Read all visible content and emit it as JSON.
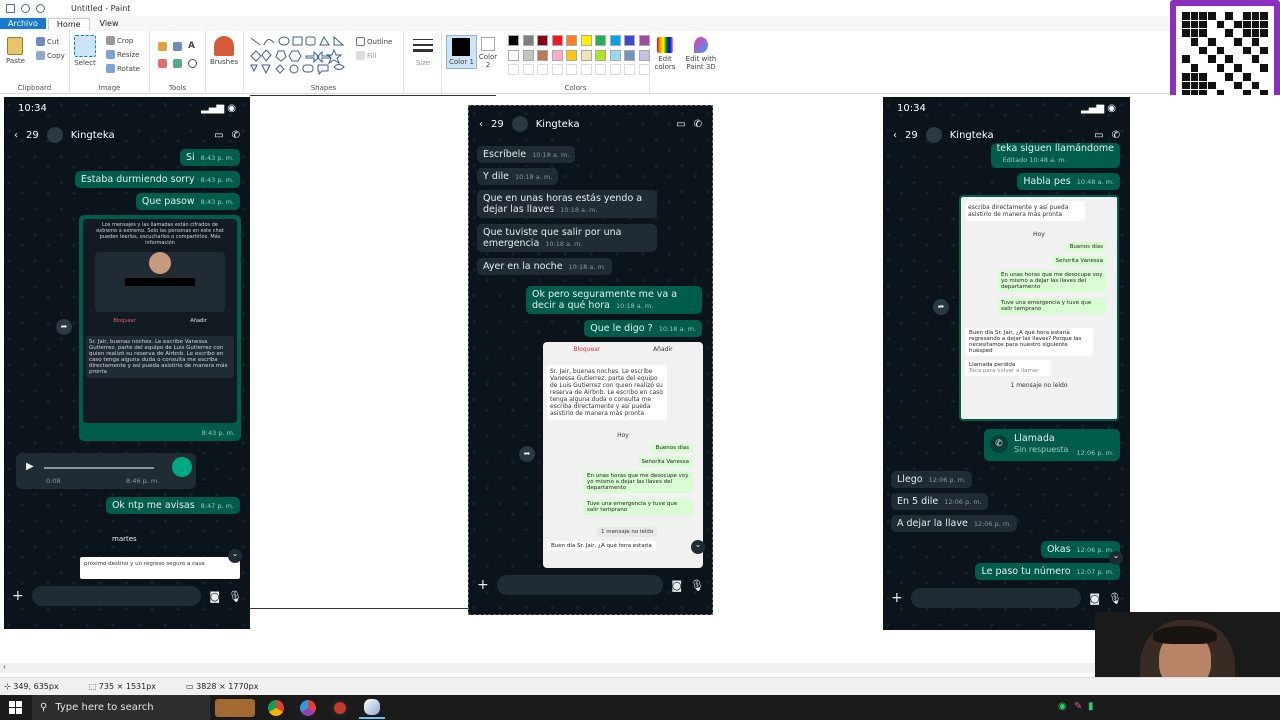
{
  "window": {
    "title": "Untitled - Paint"
  },
  "menu": {
    "file": "Archivo",
    "home": "Home",
    "view": "View"
  },
  "ribbon": {
    "clipboard": {
      "label": "Clipboard",
      "paste": "Paste",
      "cut": "Cut",
      "copy": "Copy"
    },
    "image": {
      "label": "Image",
      "select": "Select",
      "crop": "Crop",
      "resize": "Resize",
      "rotate": "Rotate"
    },
    "tools": {
      "label": "Tools"
    },
    "brushes": "Brushes",
    "shapes": {
      "label": "Shapes",
      "outline": "Outline",
      "fill": "Fill"
    },
    "size": "Size",
    "color1": "Color 1",
    "color2": "Color 2",
    "colors": {
      "label": "Colors"
    },
    "edit_colors": "Edit colors",
    "edit_paint3d": "Edit with Paint 3D"
  },
  "palette": [
    "#000000",
    "#7f7f7f",
    "#880015",
    "#ed1c24",
    "#ff7f27",
    "#fff200",
    "#22b14c",
    "#00a2e8",
    "#3f48cc",
    "#a349a4",
    "#ffffff",
    "#c3c3c3",
    "#b97a57",
    "#ffaec9",
    "#ffc90e",
    "#efe4b0",
    "#b5e61d",
    "#99d9ea",
    "#7092be",
    "#c8bfe7"
  ],
  "phone1": {
    "time": "10:34",
    "back_count": "29",
    "contact": "Kingteka",
    "messages": [
      {
        "text": "Si",
        "time": "8:43 p. m."
      },
      {
        "text": "Estaba durmiendo sorry",
        "time": "8:43 p. m."
      },
      {
        "text": "Que pasow",
        "time": "8:43 p. m."
      }
    ],
    "card_time": "8:43 p. m.",
    "card_note": "Los mensajes y las llamadas están cifrados de extremo a extremo. Solo las personas en este chat pueden leerlos, escucharlos o compartirlos. Más información",
    "card_block": "Bloquear",
    "card_add": "Añadir",
    "card_body": "Sr. Jair, buenas noches. Le escribe Vanessa Gutierrez, parte del equipo de Luis Gutierrez con quien realizó su reserva de Airbnb. Le escribo en caso tenga alguna duda o consulta me escriba directamente y así pueda asistirlo de manera más pronta",
    "audio_duration": "0:08",
    "audio_time": "8:46 p. m.",
    "ok_msg": {
      "text": "Ok ntp me avisas",
      "time": "8:47 p. m."
    },
    "day_label": "martes",
    "preview_text": "próximo destino y un regreso seguro a casa"
  },
  "phone2": {
    "back_count": "29",
    "contact": "Kingteka",
    "in_messages": [
      {
        "text": "Escríbele",
        "time": "10:18 a. m."
      },
      {
        "text": "Y dile",
        "time": "10:18 a. m."
      },
      {
        "text": "Que en unas horas estás yendo a dejar las llaves",
        "time": "10:18 a. m."
      },
      {
        "text": "Que tuviste que salir por una emergencia",
        "time": "10:18 a. m."
      },
      {
        "text": "Ayer en la noche",
        "time": "10:18 a. m."
      }
    ],
    "out_messages": [
      {
        "text": "Ok pero seguramente me va a decir a qué hora",
        "time": "10:18 a. m."
      },
      {
        "text": "Que le digo ?",
        "time": "10:18 a. m."
      }
    ],
    "shot": {
      "block": "Bloquear",
      "add": "Añadir",
      "body": "Sr. Jair, buenas noches. Le escribe Vanessa Gutierrez, parte del equipo de Luis Gutierrez con quien realizó su reserva de Airbnb. Le escribo en caso tenga alguna duda o consulta me escriba directamente y así pueda asistirlo de manera más pronta",
      "today": "Hoy",
      "m1": "Buenos días",
      "m2": "Señorita Vanessa",
      "m3": "En unas horas que me desocupe voy yo mismo a dejar las llaves del departamento",
      "m4": "Tuve una emergencia y tuve que salir temprano",
      "unread": "1 mensaje no leído",
      "tail": "Buen día Sr. Jair, ¿A qué hora estaría"
    }
  },
  "phone3": {
    "time": "10:34",
    "back_count": "29",
    "contact": "Kingteka",
    "top_cut": "teka siguen llamándome",
    "top_cut_time": "Editado 10:48 a. m.",
    "habla": {
      "text": "Habla pes",
      "time": "10:48 a. m."
    },
    "shot": {
      "head": "escriba directamente y así pueda asistirlo de manera más pronta",
      "today": "Hoy",
      "m1": "Buenos días",
      "m2": "Señorita Vanessa",
      "m3": "En unas horas que me desocupe voy yo mismo a dejar las llaves del departamento",
      "m4": "Tuve una emergencia y tuve que salir temprano",
      "reply": "Buen día Sr. Jair, ¿A qué hora estaría regresando a dejar las llaves? Porque las necesitamos para nuestro siguiente huésped",
      "missed": "Llamada perdida",
      "missed_sub": "Toca para volver a llamar",
      "unread": "1 mensaje no leído"
    },
    "call": {
      "title": "Llamada",
      "sub": "Sin respuesta",
      "time": "12:06 p. m."
    },
    "in_messages": [
      {
        "text": "Llego",
        "time": "12:06 p. m."
      },
      {
        "text": "En 5 dile",
        "time": "12:06 p. m."
      },
      {
        "text": "A dejar la llave",
        "time": "12:06 p. m."
      }
    ],
    "out_messages": [
      {
        "text": "Okas",
        "time": "12:06 p. m."
      },
      {
        "text": "Le paso tu número",
        "time": "12:07 p. m."
      }
    ]
  },
  "status": {
    "cursor": "349, 635px",
    "selection": "735 × 1531px",
    "canvas": "3828 × 1770px"
  },
  "taskbar": {
    "search": "Type here to search"
  }
}
